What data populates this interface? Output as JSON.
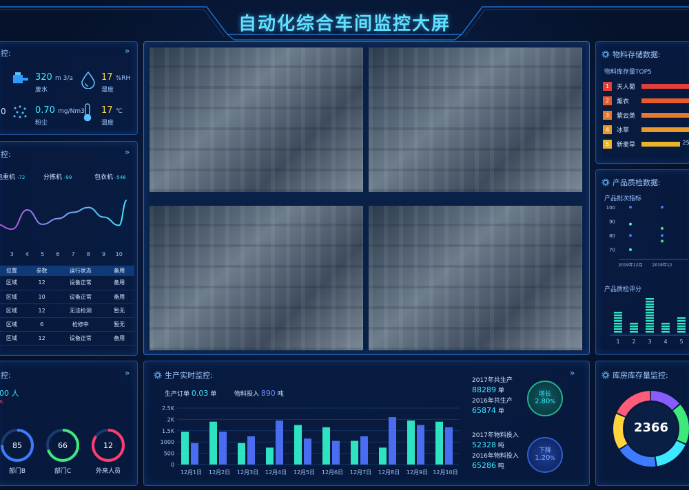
{
  "header": {
    "title": "自动化综合车间监控大屏"
  },
  "env_panel": {
    "title_fragment": "控:",
    "metrics": [
      {
        "value": "320",
        "unit": "m 3/a",
        "label": "废水",
        "icon": "water-tank-icon"
      },
      {
        "value": "17",
        "unit": "%RH",
        "label": "湿度",
        "icon": "droplet-icon"
      },
      {
        "value": "0.70",
        "unit": "mg/Nm3",
        "label": "粉尘",
        "icon": "dust-icon"
      },
      {
        "value": "17",
        "unit": "℃",
        "label": "温度",
        "icon": "thermometer-icon"
      }
    ],
    "left_partial": "0"
  },
  "equip_panel": {
    "title_fragment": "控:",
    "machines": [
      {
        "name": "包重机",
        "value": "-72"
      },
      {
        "name": "分拣机",
        "value": "-99"
      },
      {
        "name": "包衣机",
        "value": "-546"
      }
    ],
    "x_ticks": [
      "3",
      "4",
      "5",
      "6",
      "7",
      "8",
      "9",
      "10"
    ],
    "table": {
      "headers": [
        "位置",
        "参数",
        "运行状态",
        "备用"
      ],
      "rows": [
        [
          "区域",
          "12",
          "设备正常",
          "备用"
        ],
        [
          "区域",
          "10",
          "设备正常",
          "备用"
        ],
        [
          "区域",
          "12",
          "无法检测",
          "暂无"
        ],
        [
          "区域",
          "6",
          "检修中",
          "暂无"
        ],
        [
          "区域",
          "12",
          "设备正常",
          "备用"
        ]
      ]
    }
  },
  "people_panel": {
    "title_fragment": "控:",
    "count_partial": "00 人",
    "rings": [
      {
        "value": "85",
        "label": "部门B",
        "color": "#3d7bff",
        "percent": 0.75
      },
      {
        "value": "66",
        "label": "部门C",
        "color": "#3fe87a",
        "percent": 0.7
      },
      {
        "value": "12",
        "label": "外来人员",
        "color": "#ff3c6e",
        "percent": 0.85
      }
    ]
  },
  "storage_panel": {
    "title": "物料存储数据:",
    "subtitle": "物料库存量TOP5",
    "items": [
      {
        "rank": "1",
        "name": "天人菊",
        "color": "#e0403a",
        "rank_color": "#e0403a",
        "fraction": 1.0
      },
      {
        "rank": "2",
        "name": "薰衣",
        "color": "#e65a2c",
        "rank_color": "#e65a2c",
        "fraction": 1.0
      },
      {
        "rank": "3",
        "name": "紫云英",
        "color": "#e8782a",
        "rank_color": "#e8782a",
        "fraction": 1.0
      },
      {
        "rank": "4",
        "name": "冰草",
        "color": "#e89a2a",
        "rank_color": "#e89a2a",
        "fraction": 1.0
      },
      {
        "rank": "5",
        "name": "新麦草",
        "color": "#e8b52a",
        "rank_color": "#e8b52a",
        "fraction": 0.75,
        "value_partial": "25"
      }
    ]
  },
  "quality_panel": {
    "title": "产品质检数据:",
    "scatter_title": "产品批次指标",
    "scatter_y_ticks": [
      "100",
      "90",
      "80",
      "70"
    ],
    "scatter_x_ticks": [
      "2019年12月",
      "2019年12"
    ],
    "bar_title": "产品质检评分",
    "bar_x_ticks": [
      "1",
      "2",
      "3",
      "4",
      "5"
    ]
  },
  "production_panel": {
    "title": "生产实时监控:",
    "order_label": "生产订单",
    "order_value": "0.03",
    "order_unit": "单",
    "material_label": "物料投入",
    "material_value": "890",
    "material_unit": "吨",
    "stats": [
      {
        "label": "2017年共生产",
        "value": "88289",
        "unit": "单"
      },
      {
        "label": "2016年共生产",
        "value": "65874",
        "unit": "单"
      },
      {
        "label": "2017年物料投入",
        "value": "52328",
        "unit": "吨"
      },
      {
        "label": "2016年物料投入",
        "value": "65286",
        "unit": "吨"
      }
    ],
    "badge_up": {
      "label": "增长",
      "value": "2.80",
      "unit": "%"
    },
    "badge_down": {
      "label": "下降",
      "value": "1.20",
      "unit": "%"
    }
  },
  "warehouse_panel": {
    "title": "库房库存量监控:",
    "total": "2366"
  },
  "chart_data": [
    {
      "type": "bar",
      "categories": [
        "12月1日",
        "12月2日",
        "12月3日",
        "12月4日",
        "12月5日",
        "12月6日",
        "12月7日",
        "12月8日",
        "12月9日",
        "12月10日"
      ],
      "series": [
        {
          "values": [
            1450,
            1900,
            950,
            750,
            1750,
            1650,
            1050,
            750,
            1950,
            1900
          ]
        },
        {
          "values": [
            950,
            1450,
            1250,
            1950,
            1150,
            1050,
            1250,
            2100,
            1750,
            1650
          ]
        }
      ],
      "y_ticks": [
        "0",
        "500",
        "1000",
        "1.5K",
        "2K",
        "2.5K"
      ],
      "ylim": [
        0,
        2500
      ]
    },
    {
      "type": "line",
      "x": [
        2,
        3,
        4,
        5,
        6,
        7,
        8,
        9,
        10,
        10.5
      ],
      "y": [
        40,
        30,
        70,
        40,
        52,
        65,
        75,
        55,
        38,
        90
      ],
      "ylim": [
        0,
        100
      ]
    },
    {
      "type": "scatter",
      "points": [
        {
          "x": 0,
          "y": 100,
          "color": "#3d7bff"
        },
        {
          "x": 1,
          "y": 100,
          "color": "#3d7bff"
        },
        {
          "x": 0,
          "y": 88,
          "color": "#3ce8ff"
        },
        {
          "x": 1,
          "y": 85,
          "color": "#3fe87a"
        },
        {
          "x": 0,
          "y": 80,
          "color": "#3d7bff"
        },
        {
          "x": 1,
          "y": 80,
          "color": "#3d7bff"
        },
        {
          "x": 1,
          "y": 76,
          "color": "#3fe87a"
        },
        {
          "x": 0,
          "y": 70,
          "color": "#3ce8ff"
        }
      ],
      "ylim": [
        65,
        100
      ]
    },
    {
      "type": "bar",
      "categories": [
        "1",
        "2",
        "3",
        "4",
        "5"
      ],
      "values": [
        0.6,
        0.3,
        0.9,
        0.3,
        0.45
      ],
      "ylim": [
        0,
        1
      ]
    },
    {
      "type": "pie",
      "segments": [
        {
          "value": 14,
          "color": "#8a5cff"
        },
        {
          "value": 18,
          "color": "#3fe87a"
        },
        {
          "value": 16,
          "color": "#3ce8ff"
        },
        {
          "value": 18,
          "color": "#3d7bff"
        },
        {
          "value": 16,
          "color": "#ffd43c"
        },
        {
          "value": 18,
          "color": "#ff5c7a"
        }
      ]
    }
  ]
}
